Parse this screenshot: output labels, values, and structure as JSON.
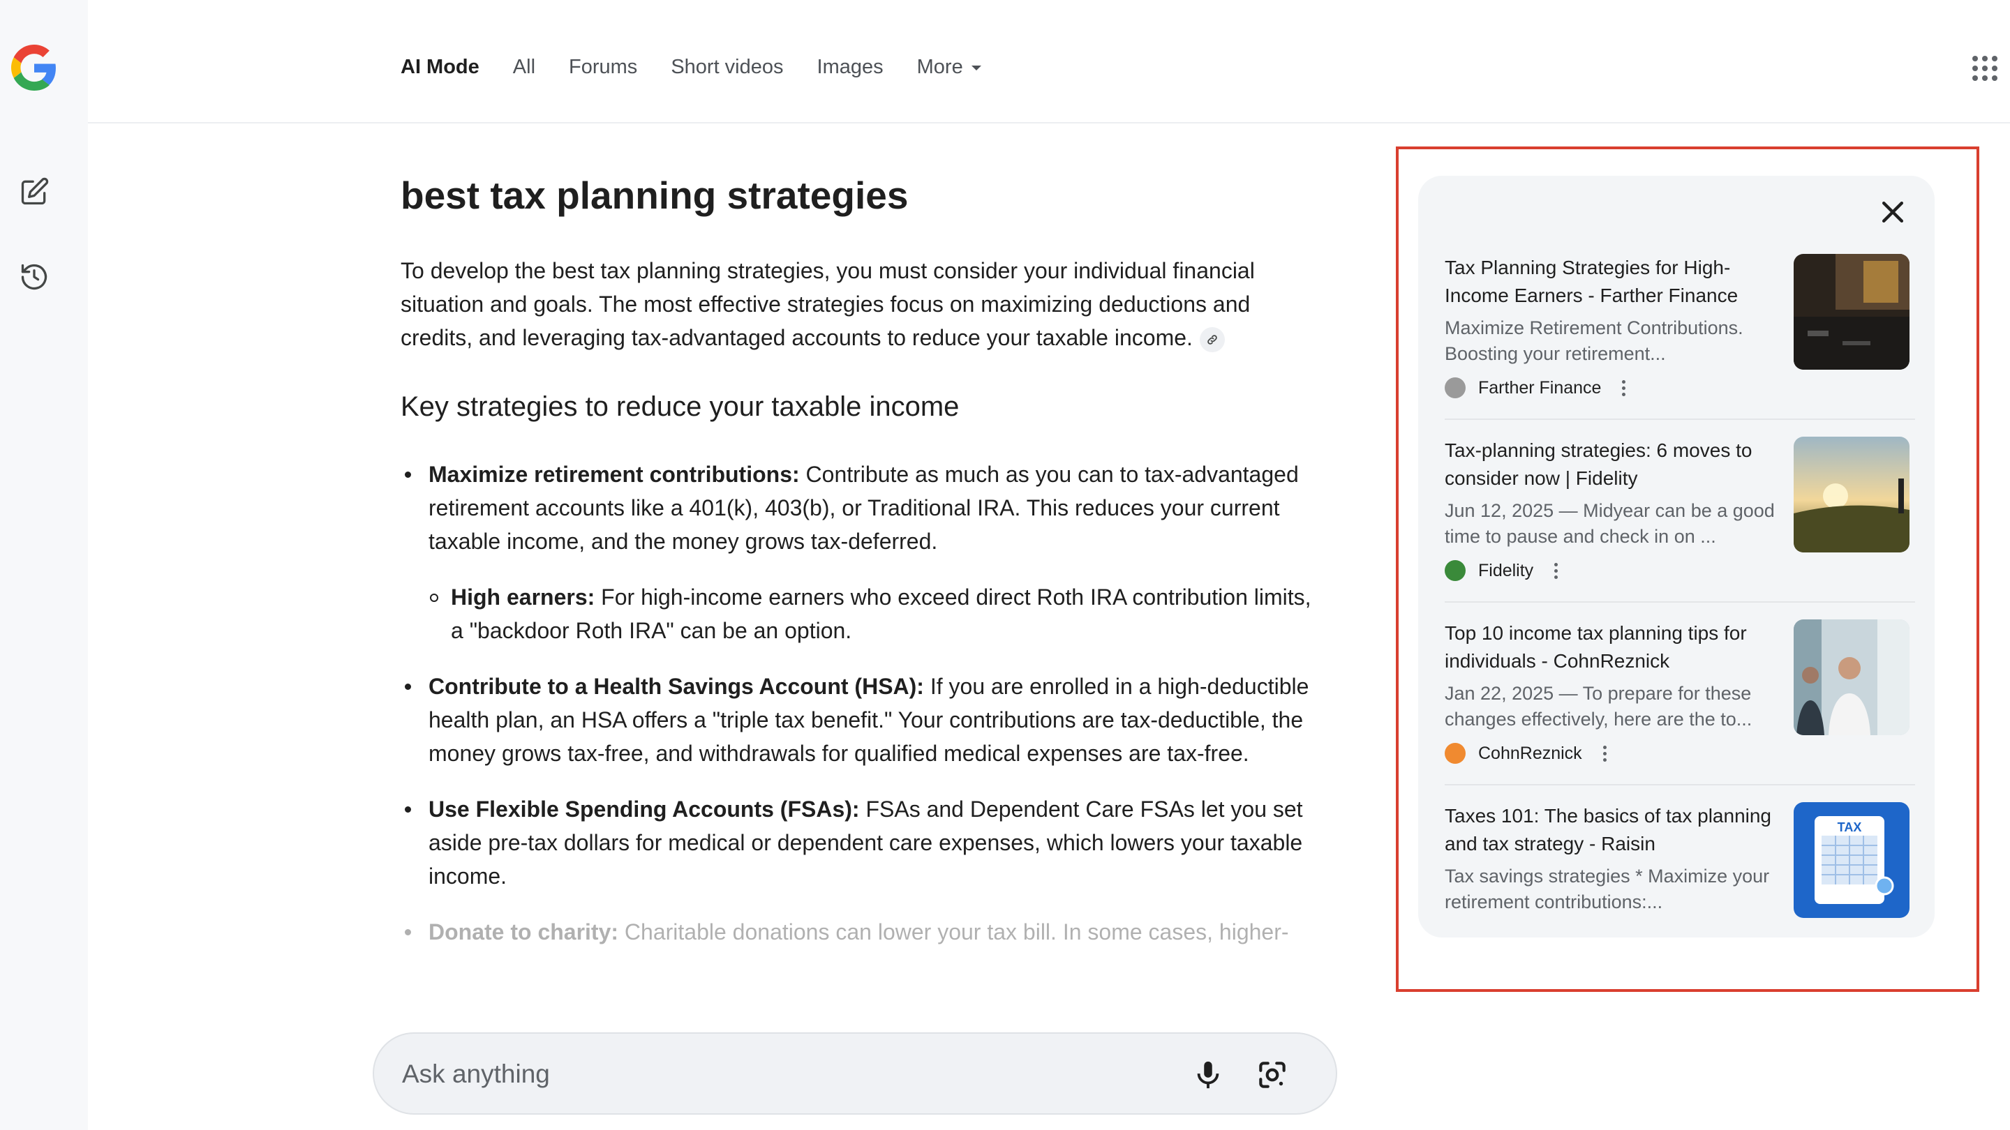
{
  "nav": {
    "tabs": [
      {
        "label": "AI Mode",
        "active": true
      },
      {
        "label": "All"
      },
      {
        "label": "Forums"
      },
      {
        "label": "Short videos"
      },
      {
        "label": "Images"
      },
      {
        "label": "More"
      }
    ]
  },
  "rail": {
    "icons": [
      "google-logo",
      "new-chat-icon",
      "history-icon"
    ]
  },
  "main": {
    "query": "best tax planning strategies",
    "intro": "To develop the best tax planning strategies, you must consider your individual financial situation and goals. The most effective strategies focus on maximizing deductions and credits, and leveraging tax-advantaged accounts to reduce your taxable income.",
    "heading": "Key strategies to reduce your taxable income",
    "bullets": [
      {
        "bold": "Maximize retirement contributions:",
        "text": " Contribute as much as you can to tax-advantaged retirement accounts like a 401(k), 403(b), or Traditional IRA. This reduces your current taxable income, and the money grows tax-deferred."
      },
      {
        "bold": "Contribute to a Health Savings Account (HSA):",
        "text": " If you are enrolled in a high-deductible health plan, an HSA offers a \"triple tax benefit.\" Your contributions are tax-deductible, the money grows tax-free, and withdrawals for qualified medical expenses are tax-free."
      },
      {
        "bold": "Use Flexible Spending Accounts (FSAs):",
        "text": " FSAs and Dependent Care FSAs let you set aside pre-tax dollars for medical or dependent care expenses, which lowers your taxable income."
      },
      {
        "bold": "Donate to charity:",
        "text": " Charitable donations can lower your tax bill. In some cases, higher-"
      }
    ],
    "sub_bullets": [
      {
        "bold": "High earners:",
        "text": " For high-income earners who exceed direct Roth IRA contribution limits, a \"backdoor Roth IRA\" can be an option."
      }
    ]
  },
  "ask": {
    "placeholder": "Ask anything"
  },
  "sources": [
    {
      "title": "Tax Planning Strategies for High-Income Earners - Farther Finance",
      "desc": "Maximize Retirement Contributions. Boosting your retirement...",
      "source": "Farther Finance",
      "favicon_color": "#8a8a8a",
      "thumb": "dark-desk"
    },
    {
      "title": "Tax-planning strategies: 6 moves to consider now | Fidelity",
      "desc": "Jun 12, 2025 — Midyear can be a good time to pause and check in on ...",
      "source": "Fidelity",
      "favicon_color": "#3a8a3a",
      "thumb": "sunrise-field"
    },
    {
      "title": "Top 10 income tax planning tips for individuals - CohnReznick",
      "desc": "Jan 22, 2025 — To prepare for these changes effectively, here are the to...",
      "source": "CohnReznick",
      "favicon_color": "#f08a30",
      "thumb": "office-meeting"
    },
    {
      "title": "Taxes 101: The basics of tax planning and tax strategy - Raisin",
      "desc": "Tax savings strategies * Maximize your retirement contributions:...",
      "thumb": "tax-form",
      "thumb_label": "TAX"
    }
  ],
  "colors": {
    "highlight": "#d93f2f",
    "panel_bg": "#f3f5f7",
    "rail_bg": "#f7f8fa"
  }
}
